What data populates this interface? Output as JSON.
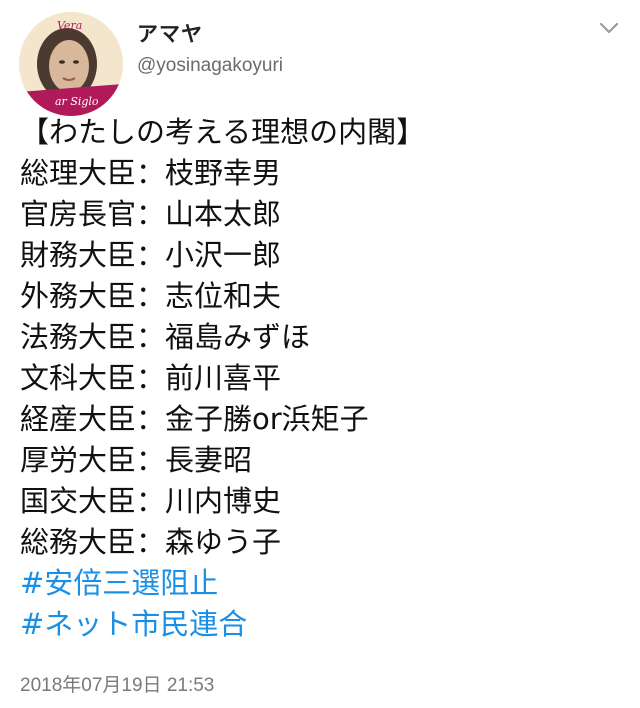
{
  "author": {
    "display_name": "アマヤ",
    "handle": "@yosinagakoyuri",
    "avatar_text_top": "Vera",
    "avatar_text_bottom": "ar Siglo"
  },
  "menu_icon": "chevron-down-icon",
  "tweet": {
    "title": "【わたしの考える理想の内閣】",
    "lines": [
      "総理大臣：枝野幸男",
      "官房長官：山本太郎",
      "財務大臣：小沢一郎",
      "外務大臣：志位和夫",
      "法務大臣：福島みずほ",
      "文科大臣：前川喜平",
      "経産大臣：金子勝or浜矩子",
      "厚労大臣：長妻昭",
      "国交大臣：川内博史",
      "総務大臣：森ゆう子"
    ],
    "hashtags": [
      "#安倍三選阻止",
      "#ネット市民連合"
    ],
    "timestamp": "2018年07月19日 21:53"
  },
  "colors": {
    "hashtag": "#1a8fe6",
    "avatar_band": "#b0195a"
  }
}
